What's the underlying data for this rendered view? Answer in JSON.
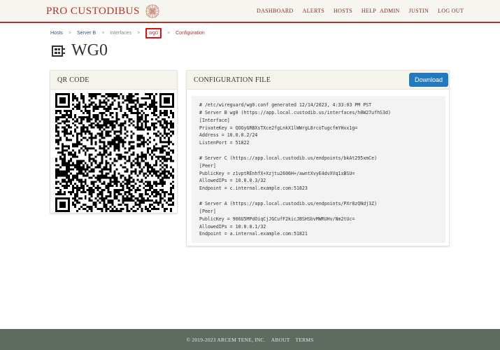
{
  "header": {
    "brand": "PRO CUSTODIBUS",
    "nav_left": [
      "DASHBOARD",
      "ALERTS",
      "HOSTS",
      "HELP"
    ],
    "nav_right": [
      "ADMIN",
      "JUSTIN",
      "LOG OUT"
    ],
    "accent_color": "#b5302a"
  },
  "breadcrumb": {
    "items": [
      "Hosts",
      "Server B",
      "Interfaces",
      "wg0",
      "Configuration"
    ],
    "separator": ">"
  },
  "page": {
    "title": "WG0"
  },
  "qr_panel": {
    "title": "QR CODE"
  },
  "config_panel": {
    "title": "CONFIGURATION FILE",
    "download_label": "Download",
    "lines": [
      "# /etc/wireguard/wg0.conf generated 12/14/2023, 4:33:03 PM PST",
      "# Server B wg0 (https://app.local.custodib.us/interfaces/h8W27ufhS3d)",
      "[Interface]",
      "PrivateKey = QOGyGRBXsTXce2fgLnkX1lWWrgL8rcoTugcfmYHxx1g=",
      "Address = 10.0.0.2/24",
      "ListenPort = 51822",
      "",
      "# Server C (https://app.local.custodib.us/endpoints/bkAt295xmCe)",
      "[Peer]",
      "PublicKey = z1vptREnhfX+Xzjtu2606H+/awntXvyE4dvXVq1xBSU=",
      "AllowedIPs = 10.0.0.3/32",
      "Endpoint = c.internal.example.com:51823",
      "",
      "# Server A (https://app.local.custodib.us/endpoints/PXr8zQNdj3Z)",
      "[Peer]",
      "PublicKey = 906U5MPdOiqCjJGCufF2kicJBSHSbvMWRUHv/Nm2tUc=",
      "AllowedIPs = 10.0.0.1/32",
      "Endpoint = a.internal.example.com:51821"
    ]
  },
  "footer": {
    "copyright": "© 2019-2023 ARCEM TENE, INC.",
    "links": [
      "ABOUT",
      "TERMS"
    ]
  }
}
